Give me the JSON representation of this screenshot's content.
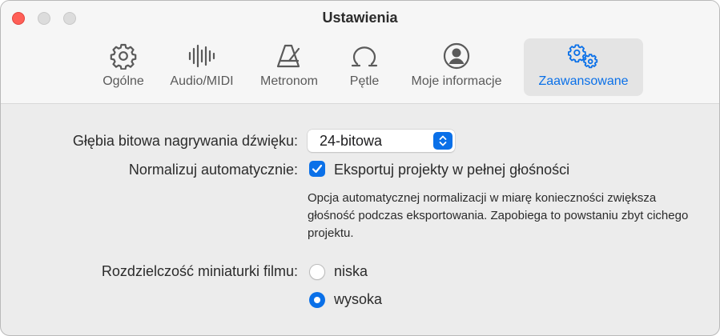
{
  "window": {
    "title": "Ustawienia"
  },
  "tabs": [
    {
      "label": "Ogólne",
      "icon": "gear-icon"
    },
    {
      "label": "Audio/MIDI",
      "icon": "waveform-icon"
    },
    {
      "label": "Metronom",
      "icon": "metronome-icon"
    },
    {
      "label": "Pętle",
      "icon": "loop-icon"
    },
    {
      "label": "Moje informacje",
      "icon": "person-circle-icon"
    },
    {
      "label": "Zaawansowane",
      "icon": "gears-icon",
      "selected": true
    }
  ],
  "settings": {
    "bit_depth": {
      "label": "Głębia bitowa nagrywania dźwięku:",
      "value": "24-bitowa"
    },
    "normalize": {
      "label": "Normalizuj automatycznie:",
      "checkbox_label": "Eksportuj projekty w pełnej głośności",
      "checked": true,
      "help": "Opcja automatycznej normalizacji w miarę konieczności zwiększa głośność podczas eksportowania. Zapobiega to powstaniu zbyt cichego projektu."
    },
    "thumbnail": {
      "label": "Rozdzielczość miniaturki filmu:",
      "options": [
        "niska",
        "wysoka"
      ],
      "selected": "wysoka"
    }
  },
  "colors": {
    "accent": "#0a70e8",
    "close": "#ff5f57"
  }
}
